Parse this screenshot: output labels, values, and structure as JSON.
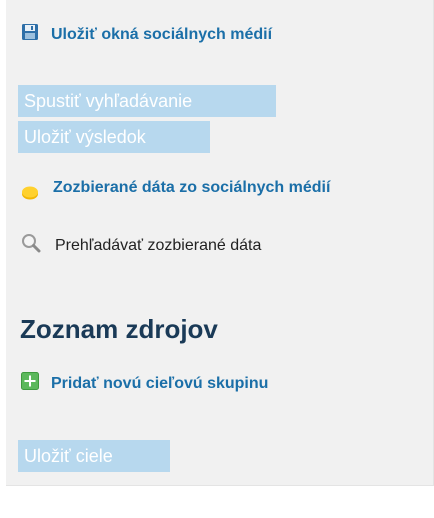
{
  "sidebar": {
    "save_windows_link": "Uložiť okná sociálnych médií",
    "start_search_button": "Spustiť vyhľadávanie",
    "save_result_button": "Uložiť výsledok",
    "collected_data_link": "Zozbierané dáta zo sociálnych médií",
    "browse_collected_link": "Prehľadávať zozbierané dáta",
    "sources_heading": "Zoznam zdrojov",
    "add_target_group_link": "Pridať novú cieľovú skupinu",
    "save_targets_button": "Uložiť ciele"
  },
  "icons": {
    "save": "floppy-disk-icon",
    "collected": "database-icon",
    "browse": "magnifier-icon",
    "add": "plus-icon"
  },
  "colors": {
    "link": "#1b6fa8",
    "heading": "#1a3a57",
    "button_disabled": "#b7d8ee",
    "panel_bg": "#f1f1f1"
  }
}
